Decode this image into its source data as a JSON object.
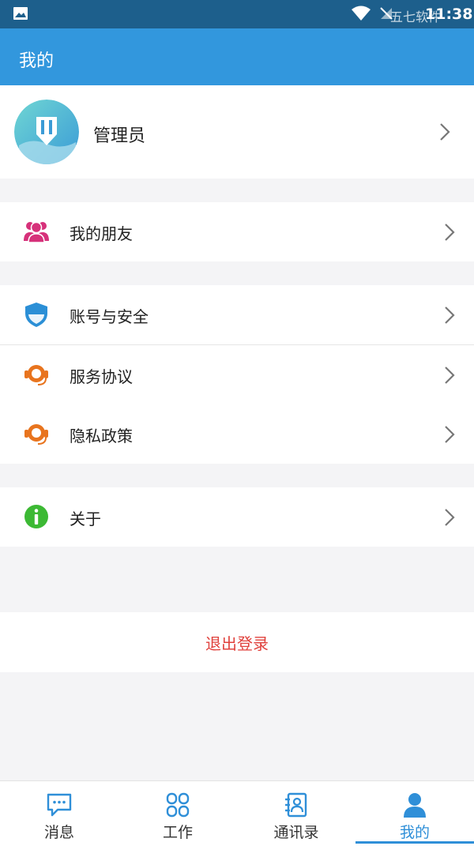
{
  "status_bar": {
    "time": "11:38",
    "watermark": "五七软件",
    "icons": [
      "image-icon",
      "wifi-icon",
      "sim-icon"
    ]
  },
  "header": {
    "title": "我的",
    "color": "#3297dd"
  },
  "profile": {
    "name": "管理员"
  },
  "menu": {
    "friends": {
      "label": "我的朋友",
      "icon": "users-icon",
      "color": "#d6317a"
    },
    "account": {
      "label": "账号与安全",
      "icon": "shield-icon",
      "color": "#2b8fd6"
    },
    "service": {
      "label": "服务协议",
      "icon": "headset-icon",
      "color": "#e8741e"
    },
    "privacy": {
      "label": "隐私政策",
      "icon": "headset-icon",
      "color": "#e8741e"
    },
    "about": {
      "label": "关于",
      "icon": "info-icon",
      "color": "#3cb934"
    }
  },
  "logout": {
    "label": "退出登录",
    "color": "#e0413c"
  },
  "tabs": [
    {
      "label": "消息",
      "icon": "chat-icon",
      "active": false
    },
    {
      "label": "工作",
      "icon": "grid-icon",
      "active": false
    },
    {
      "label": "通讯录",
      "icon": "contacts-icon",
      "active": false
    },
    {
      "label": "我的",
      "icon": "person-icon",
      "active": true
    }
  ]
}
